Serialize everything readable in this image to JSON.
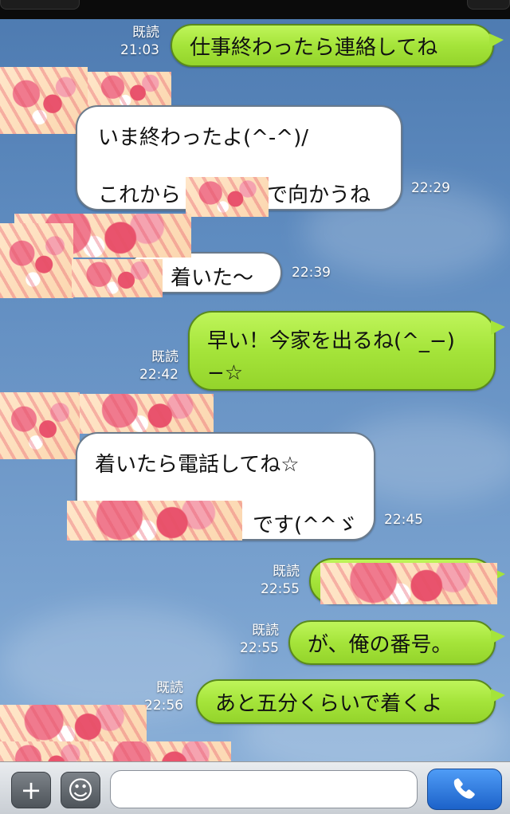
{
  "messages": [
    {
      "text": "仕事終わったら連絡してね",
      "read": "既読",
      "time": "21:03"
    },
    {
      "line1": "いま終わったよ(^-^)/",
      "line2_after": "で向かうね",
      "line2_before": "これから",
      "time": "22:29"
    },
    {
      "text": "着いた～",
      "time": "22:39"
    },
    {
      "text": "早い！今家を出るね(^_−)−☆",
      "read": "既読",
      "time": "22:42"
    },
    {
      "line1": "着いたら電話してね☆",
      "line2_after": "です(^^ゞ",
      "time": "22:45"
    },
    {
      "read": "既読",
      "time": "22:55"
    },
    {
      "text": "が、俺の番号。",
      "read": "既読",
      "time": "22:55"
    },
    {
      "text": "あと五分くらいで着くよ",
      "read": "既読",
      "time": "22:56"
    }
  ],
  "input": {
    "placeholder": ""
  },
  "icons": {
    "plus": "+",
    "smile": "☺",
    "phone": "☎"
  }
}
